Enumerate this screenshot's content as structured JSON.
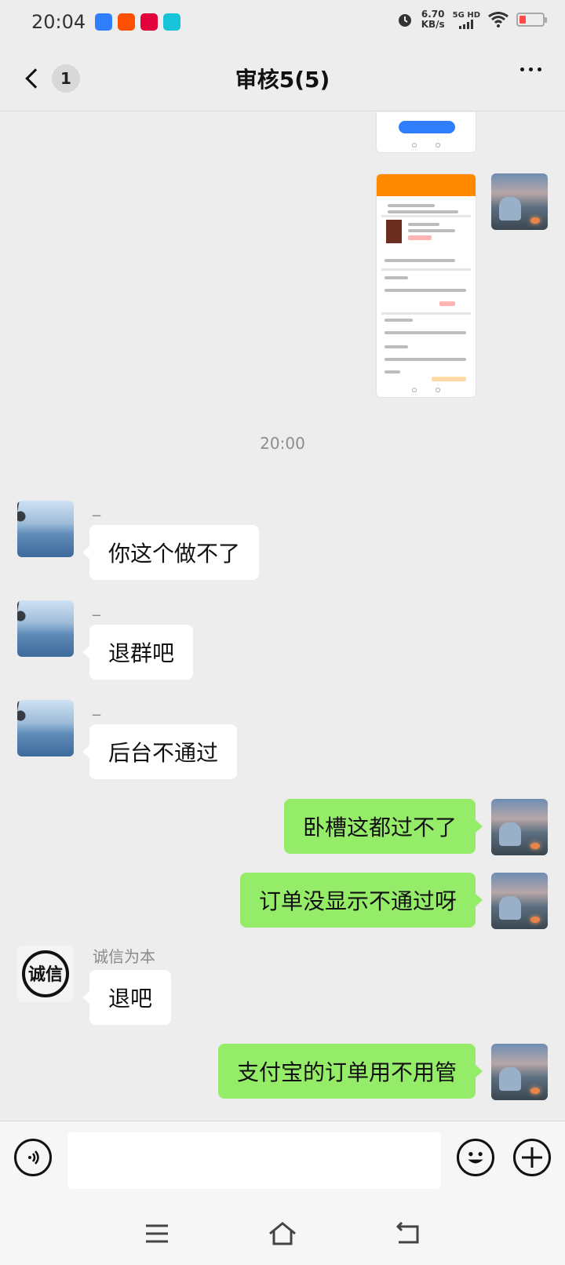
{
  "status_bar": {
    "time": "20:04",
    "app_icons": [
      {
        "name": "browser-app-icon",
        "color": "#2f7dfb"
      },
      {
        "name": "shopping-app-icon",
        "color": "#ff5000"
      },
      {
        "name": "tmall-app-icon",
        "color": "#e4003a"
      },
      {
        "name": "wifi-app-icon",
        "color": "#17c3d8"
      }
    ],
    "net_speed_value": "6.70",
    "net_speed_unit": "KB/s",
    "network_label": "5G HD"
  },
  "header": {
    "unread_count": "1",
    "title": "审核5(5)"
  },
  "chat": {
    "time_divider": "20:00",
    "messages": [
      {
        "sender": "_",
        "text": "你这个做不了"
      },
      {
        "sender": "_",
        "text": "退群吧"
      },
      {
        "sender": "_",
        "text": "后台不通过"
      },
      {
        "text": "卧槽这都过不了"
      },
      {
        "text": "订单没显示不通过呀"
      },
      {
        "sender": "诚信为本",
        "text": "退吧"
      },
      {
        "text": "支付宝的订单用不用管"
      }
    ],
    "seal_text": "诚信"
  },
  "colors": {
    "background": "#ededed",
    "bubble_incoming": "#ffffff",
    "bubble_outgoing": "#95ec69",
    "accent_orange": "#ff8a00"
  }
}
